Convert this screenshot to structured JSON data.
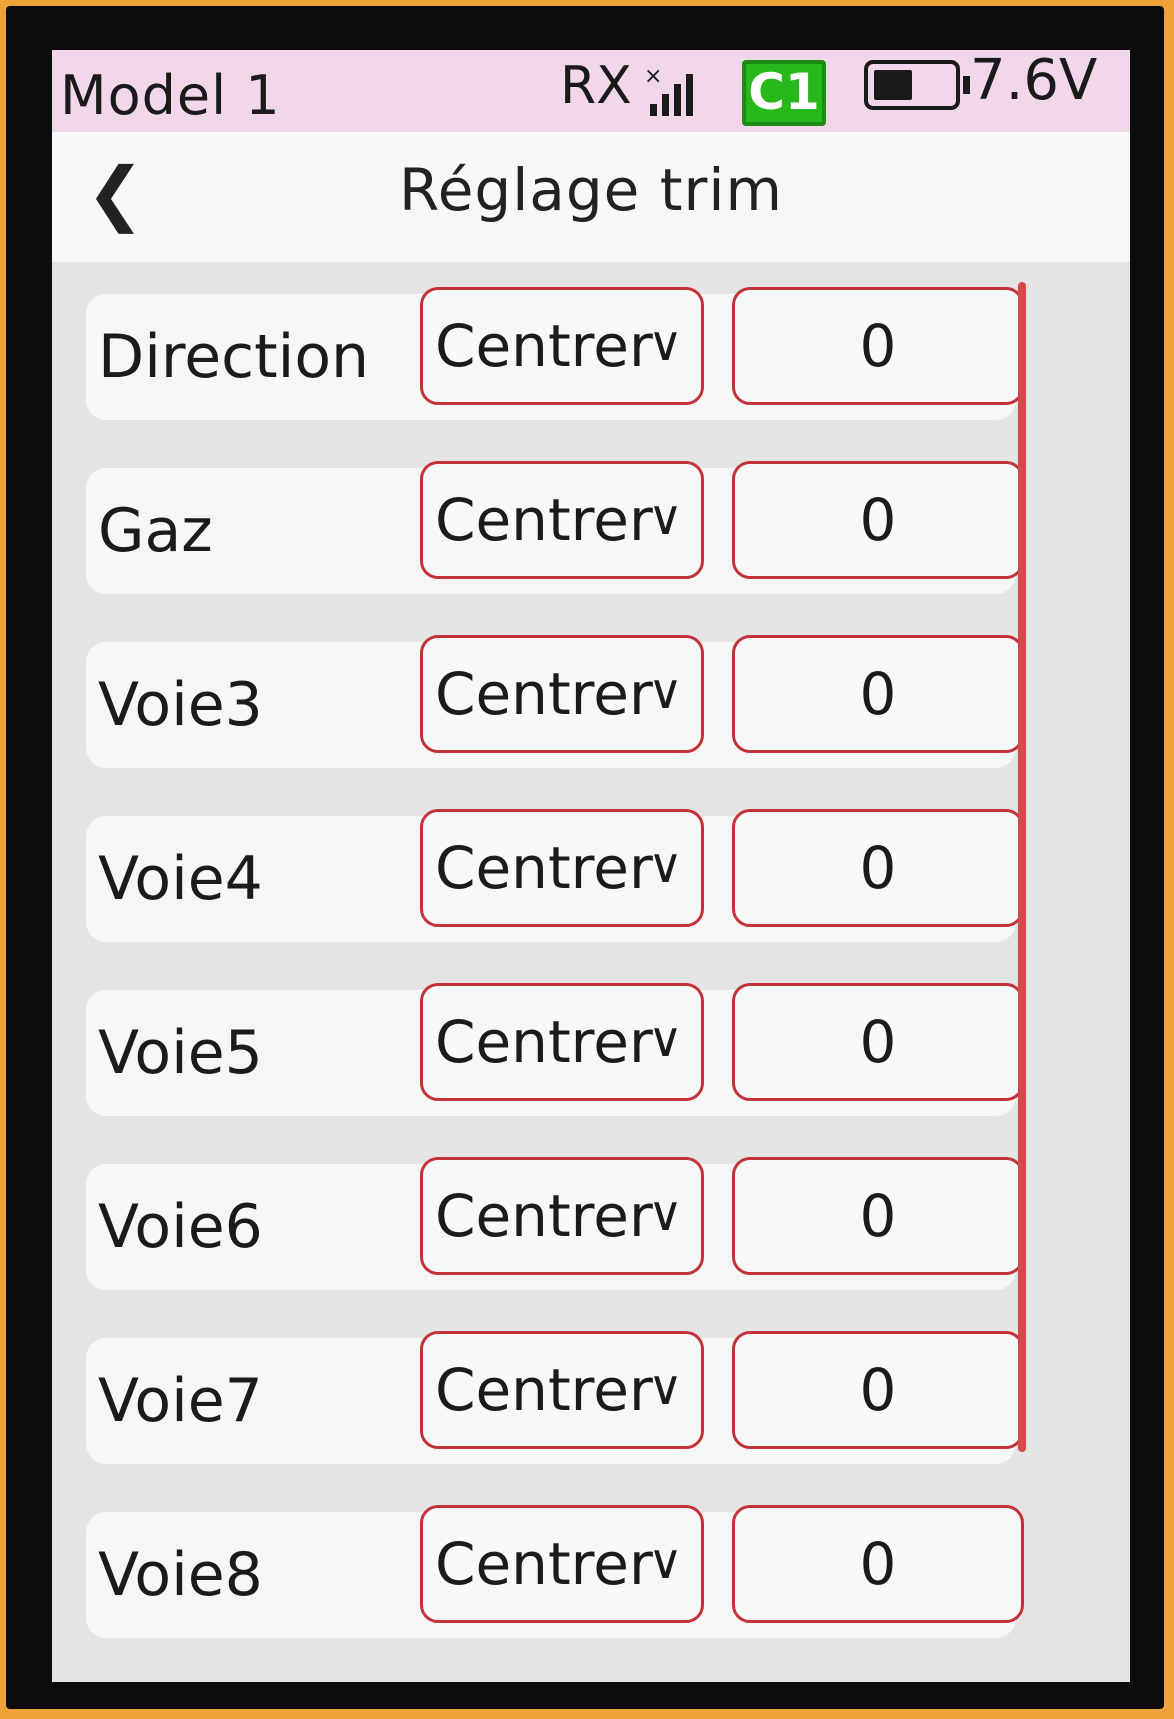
{
  "status": {
    "model": "Model 1",
    "rx": "RX",
    "channel_badge": "C1",
    "battery_level": 0.5,
    "voltage": "7.6V"
  },
  "header": {
    "back_icon": "chevron-left-icon",
    "title": "Réglage trim"
  },
  "rows": [
    {
      "label": "Direction",
      "mode": "Centrer",
      "value": "0"
    },
    {
      "label": "Gaz",
      "mode": "Centrer",
      "value": "0"
    },
    {
      "label": "Voie3",
      "mode": "Centrer",
      "value": "0"
    },
    {
      "label": "Voie4",
      "mode": "Centrer",
      "value": "0"
    },
    {
      "label": "Voie5",
      "mode": "Centrer",
      "value": "0"
    },
    {
      "label": "Voie6",
      "mode": "Centrer",
      "value": "0"
    },
    {
      "label": "Voie7",
      "mode": "Centrer",
      "value": "0"
    },
    {
      "label": "Voie8",
      "mode": "Centrer",
      "value": "0"
    }
  ],
  "colors": {
    "accent": "#c3343a",
    "status_bar": "#f2d7ea",
    "badge_green": "#27b81c"
  }
}
